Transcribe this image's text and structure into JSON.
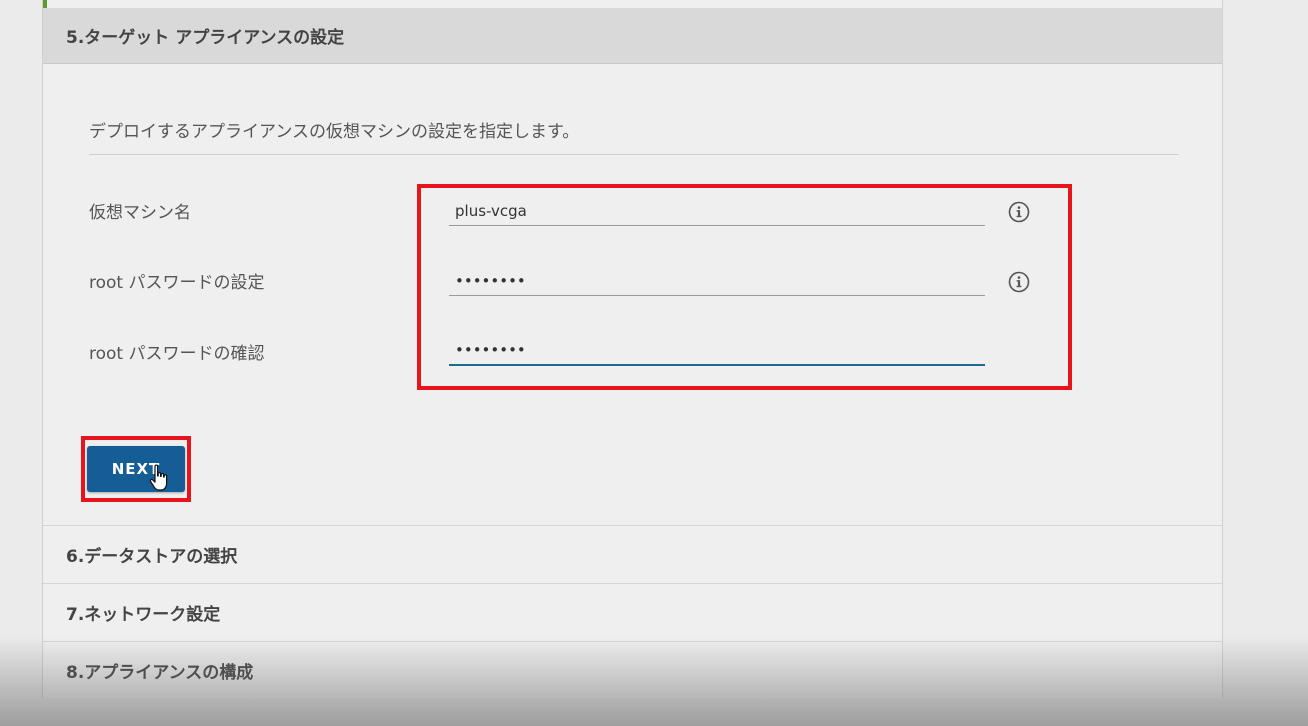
{
  "active_step": {
    "title": "5.ターゲット アプライアンスの設定",
    "description": "デプロイするアプライアンスの仮想マシンの設定を指定します。",
    "fields": [
      {
        "label": "仮想マシン名",
        "value": "plus-vcga"
      },
      {
        "label": "root パスワードの設定",
        "value": "password"
      },
      {
        "label": "root パスワードの確認",
        "value": "password"
      }
    ],
    "next_label": "NEXT"
  },
  "collapsed_steps": [
    {
      "title": "6.データストアの選択"
    },
    {
      "title": "7.ネットワーク設定"
    },
    {
      "title": "8.アプライアンスの構成"
    }
  ],
  "icons": {
    "info": "info-circle-icon",
    "cursor": "hand-pointer-icon"
  },
  "colors": {
    "primary_button": "#155e95",
    "highlight": "#e8141b",
    "focus_underline": "#1e6d8e",
    "accent": "#5c9a2e"
  }
}
